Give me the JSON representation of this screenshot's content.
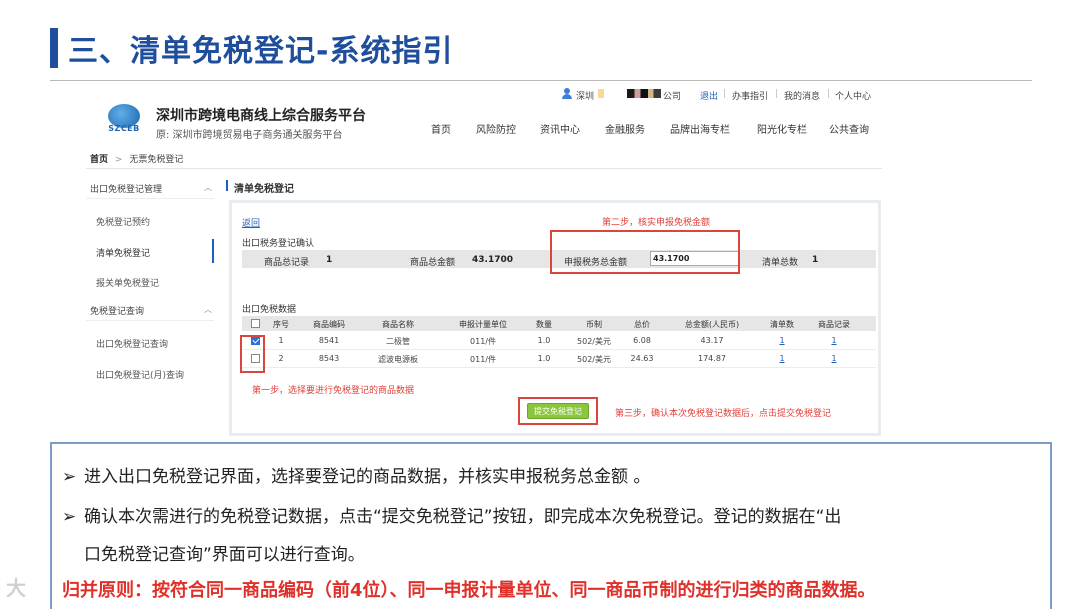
{
  "slide": {
    "title": "三、清单免税登记-系统指引"
  },
  "topbar": {
    "user": "深圳",
    "company": "公司",
    "logout": "退出",
    "guide": "办事指引",
    "messages": "我的消息",
    "profile": "个人中心"
  },
  "header": {
    "logo_text": "SZCEB",
    "site_name": "深圳市跨境电商线上综合服务平台",
    "site_sub": "原:  深圳市跨境贸易电子商务通关服务平台",
    "nav": [
      "首页",
      "风险防控",
      "资讯中心",
      "金融服务",
      "品牌出海专栏",
      "阳光化专栏",
      "公共查询"
    ]
  },
  "breadcrumb": {
    "home": "首页",
    "sep": ">",
    "current": "无票免税登记"
  },
  "sidebar": {
    "group1": "出口免税登记管理",
    "items1": [
      "免税登记预约",
      "清单免税登记",
      "报关单免税登记"
    ],
    "group2": "免税登记查询",
    "items2": [
      "出口免税登记查询",
      "出口免税登记(月)查询"
    ]
  },
  "main": {
    "title": "清单免税登记",
    "back": "返回",
    "step2": "第二步，核实申报免税金额",
    "confirm_title": "出口税务登记确认",
    "summary": {
      "total_records_label": "商品总记录",
      "total_records": "1",
      "total_amount_label": "商品总金额",
      "total_amount": "43.1700",
      "tax_amount_label": "申报税务总金额",
      "tax_amount": "43.1700",
      "list_count_label": "清单总数",
      "list_count": "1"
    },
    "data_title": "出口免税数据",
    "columns": [
      "序号",
      "商品编码",
      "商品名称",
      "申报计量单位",
      "数量",
      "币制",
      "总价",
      "总金额(人民币)",
      "清单数",
      "商品记录"
    ],
    "rows": [
      {
        "checked": true,
        "cells": [
          "1",
          "8541",
          "二极管",
          "011/件",
          "1.0",
          "502/美元",
          "6.08",
          "43.17",
          "1",
          "1"
        ]
      },
      {
        "checked": false,
        "cells": [
          "2",
          "8543",
          "滤波电源板",
          "011/件",
          "1.0",
          "502/美元",
          "24.63",
          "174.87",
          "1",
          "1"
        ]
      }
    ],
    "step1": "第一步，选择要进行免税登记的商品数据",
    "submit": "提交免税登记",
    "step3": "第三步，确认本次免税登记数据后，点击提交免税登记"
  },
  "notes": {
    "arrow": "➢",
    "line1": "进入出口免税登记界面，选择要登记的商品数据，并核实申报税务总金额 。",
    "line2a": "确认本次需进行的免税登记数据，点击“提交免税登记”按钮，即完成本次免税登记。登记的数据在“出",
    "line2b": "口免税登记查询”界面可以进行查询。",
    "rule": "归并原则：按符合同一商品编码（前4位）、同一申报计量单位、同一商品币制的进行归类的商品数据。"
  },
  "watermark": "大"
}
